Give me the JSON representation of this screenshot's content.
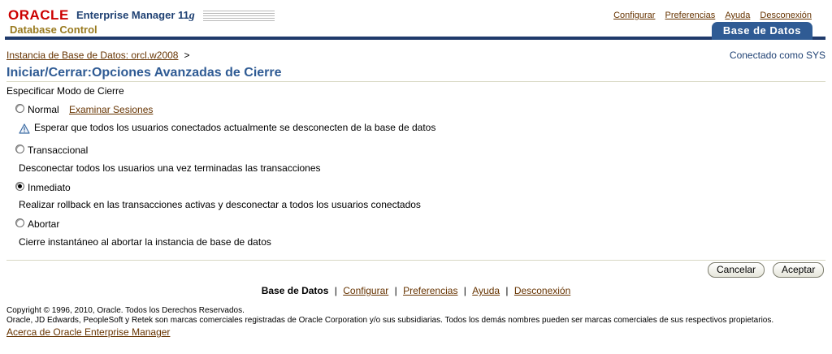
{
  "header": {
    "brand_oracle": "ORACLE",
    "brand_product": "Enterprise Manager 11",
    "brand_version_g": "g",
    "brand_sub": "Database Control",
    "global_links": [
      "Configurar",
      "Preferencias",
      "Ayuda",
      "Desconexión"
    ],
    "active_tab": "Base de Datos"
  },
  "breadcrumb": {
    "link": "Instancia de Base de Datos: orcl.w2008",
    "separator": ">"
  },
  "connected_as": "Conectado como SYS",
  "page_title": "Iniciar/Cerrar:Opciones Avanzadas de Cierre",
  "section_label": "Especificar Modo de Cierre",
  "options": {
    "normal": {
      "label": "Normal",
      "link": "Examinar Sesiones",
      "description": "Esperar que todos los usuarios conectados actualmente se desconecten de la base de datos",
      "selected": false
    },
    "transactional": {
      "label": "Transaccional",
      "description": "Desconectar todos los usuarios una vez terminadas las transacciones",
      "selected": false
    },
    "immediate": {
      "label": "Inmediato",
      "description": "Realizar rollback en las transacciones activas y desconectar a todos los usuarios conectados",
      "selected": true
    },
    "abort": {
      "label": "Abortar",
      "description": "Cierre instantáneo al abortar la instancia de base de datos",
      "selected": false
    }
  },
  "buttons": {
    "cancel": "Cancelar",
    "accept": "Aceptar"
  },
  "footer": {
    "current": "Base de Datos",
    "links": [
      "Configurar",
      "Preferencias",
      "Ayuda",
      "Desconexión"
    ],
    "separator": "|",
    "copyright_line1": "Copyright © 1996, 2010, Oracle. Todos los Derechos Reservados.",
    "copyright_line2": "Oracle, JD Edwards, PeopleSoft y Retek son marcas comerciales registradas de Oracle Corporation y/o sus subsidiarias. Todos los demás nombres pueden ser marcas comerciales de sus respectivos propietarios.",
    "about_link": "Acerca de Oracle Enterprise Manager"
  },
  "colors": {
    "brand_red": "#cc0000",
    "title_blue": "#2f5b94",
    "link_brown": "#663300",
    "header_bar": "#1f3a6b"
  }
}
